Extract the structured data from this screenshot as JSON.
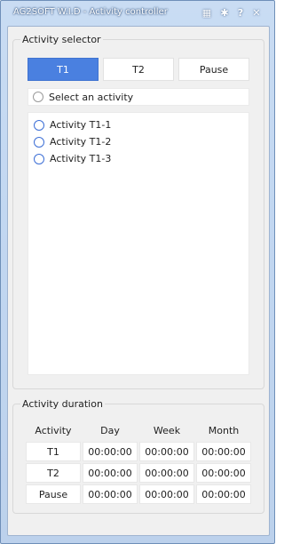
{
  "window": {
    "title": "AG2SOFT W.I.D - Activity controller",
    "icons": [
      "calculator-icon",
      "gear-icon",
      "help-icon",
      "close-icon"
    ],
    "icon_glyphs": {
      "calculator": "▦",
      "gear": "✱",
      "help": "?",
      "close": "✕"
    }
  },
  "activity_selector": {
    "title": "Activity selector",
    "tabs": [
      "T1",
      "T2",
      "Pause"
    ],
    "active_tab": "T1",
    "select_label": "Select an activity",
    "activities": [
      "Activity T1-1",
      "Activity T1-2",
      "Activity T1-3"
    ]
  },
  "activity_duration": {
    "title": "Activity duration",
    "headers": [
      "Activity",
      "Day",
      "Week",
      "Month"
    ],
    "rows": [
      {
        "label": "T1",
        "day": "00:00:00",
        "week": "00:00:00",
        "month": "00:00:00"
      },
      {
        "label": "T2",
        "day": "00:00:00",
        "week": "00:00:00",
        "month": "00:00:00"
      },
      {
        "label": "Pause",
        "day": "00:00:00",
        "week": "00:00:00",
        "month": "00:00:00"
      }
    ]
  },
  "colors": {
    "accent": "#4a80e0",
    "radio_active": "#3d6fd6",
    "title_bar": "#c2d7f1"
  }
}
